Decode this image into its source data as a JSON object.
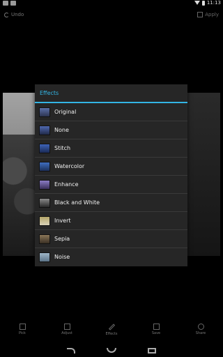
{
  "status_bar": {
    "time": "11:13"
  },
  "action_bar": {
    "undo_label": "Undo",
    "apply_label": "Apply"
  },
  "dialog": {
    "title": "Effects",
    "accent_color": "#33b5e5",
    "items": [
      {
        "label": "Original",
        "thumb_color": "#5b6fa8"
      },
      {
        "label": "None",
        "thumb_color": "#4f68b0"
      },
      {
        "label": "Stitch",
        "thumb_color": "#3d63b8"
      },
      {
        "label": "Watercolor",
        "thumb_color": "#3f6fc0"
      },
      {
        "label": "Enhance",
        "thumb_color": "#8b7cc4"
      },
      {
        "label": "Black and White",
        "thumb_color": "#6a6a6a"
      },
      {
        "label": "Invert",
        "thumb_color": "#b5a66a"
      },
      {
        "label": "Sepia",
        "thumb_color": "#8a7658"
      },
      {
        "label": "Noise",
        "thumb_color": "#7fa0b8"
      }
    ]
  },
  "toolbar": {
    "items": [
      {
        "label": "Pick",
        "icon": "image-icon"
      },
      {
        "label": "Adjust",
        "icon": "sliders-icon"
      },
      {
        "label": "Effects",
        "icon": "pencil-icon"
      },
      {
        "label": "Save",
        "icon": "save-icon"
      },
      {
        "label": "Share",
        "icon": "share-icon"
      }
    ]
  }
}
